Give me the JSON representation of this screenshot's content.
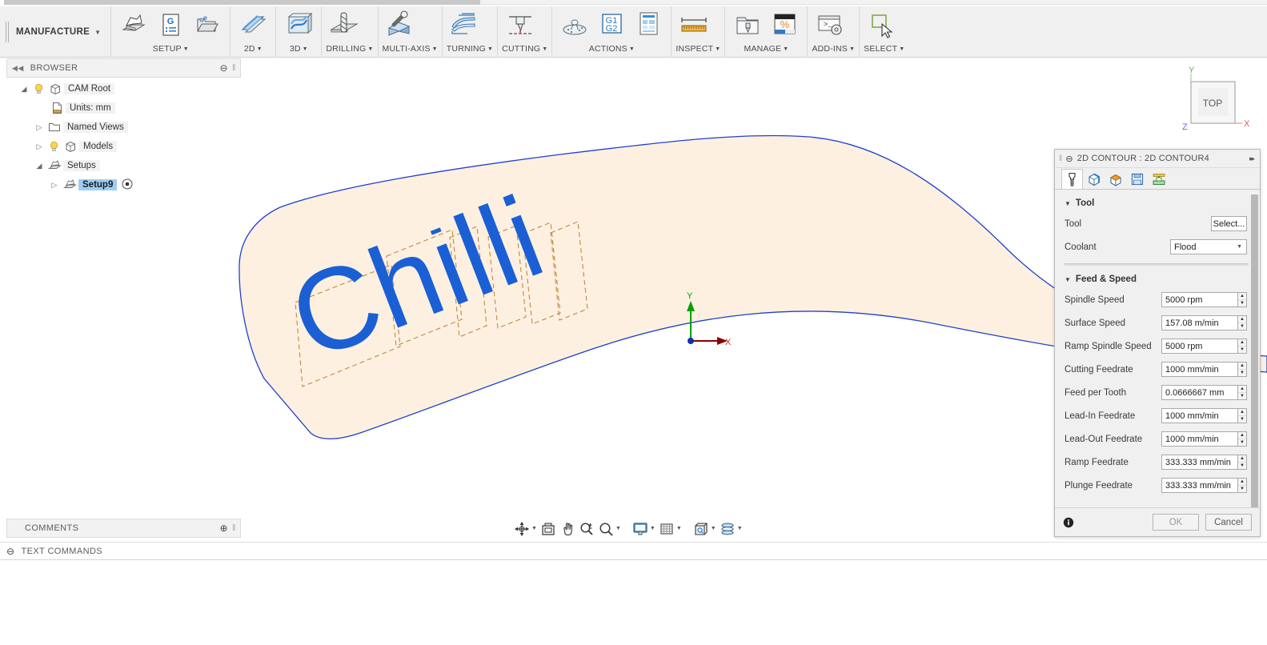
{
  "app": {
    "workspace": "MANUFACTURE"
  },
  "ribbon": {
    "groups": [
      {
        "label": "SETUP",
        "icons": [
          "setup-icon",
          "generate-nc-icon",
          "setup-folder-icon"
        ]
      },
      {
        "label": "2D",
        "icons": [
          "2d-toolpath-icon"
        ]
      },
      {
        "label": "3D",
        "icons": [
          "3d-toolpath-icon"
        ]
      },
      {
        "label": "DRILLING",
        "icons": [
          "drilling-icon"
        ]
      },
      {
        "label": "MULTI-AXIS",
        "icons": [
          "multi-axis-icon"
        ]
      },
      {
        "label": "TURNING",
        "icons": [
          "turning-icon"
        ]
      },
      {
        "label": "CUTTING",
        "icons": [
          "cutting-icon"
        ]
      },
      {
        "label": "ACTIONS",
        "icons": [
          "simulate-icon",
          "g1g2-icon",
          "setup-sheet-icon"
        ]
      },
      {
        "label": "INSPECT",
        "icons": [
          "measure-icon"
        ]
      },
      {
        "label": "MANAGE",
        "icons": [
          "tool-library-icon",
          "machining-time-icon"
        ]
      },
      {
        "label": "ADD-INS",
        "icons": [
          "addins-icon"
        ]
      },
      {
        "label": "SELECT",
        "icons": [
          "select-icon"
        ]
      }
    ]
  },
  "browser": {
    "title": "BROWSER",
    "tree": [
      {
        "label": "CAM Root",
        "icon": "body-icon",
        "twist": "expanded",
        "bulb": true,
        "indent": 0
      },
      {
        "label": "Units: mm",
        "icon": "units-icon",
        "twist": "none",
        "bulb": false,
        "indent": 1
      },
      {
        "label": "Named Views",
        "icon": "folder-icon",
        "twist": "collapsed",
        "bulb": false,
        "indent": 1
      },
      {
        "label": "Models",
        "icon": "body-icon",
        "twist": "collapsed",
        "bulb": true,
        "indent": 1
      },
      {
        "label": "Setups",
        "icon": "setup-small-icon",
        "twist": "expanded",
        "bulb": false,
        "indent": 1
      },
      {
        "label": "Setup9",
        "icon": "setup-small-icon",
        "twist": "collapsed",
        "bulb": false,
        "indent": 2,
        "selected": true,
        "trailing_icon": "target-icon"
      }
    ]
  },
  "canvas": {
    "body_text": "Chilli",
    "body_fill": "#fdf0e1",
    "body_outline": "#2040d0",
    "text_color": "#1b5fd4",
    "selection_box_color": "#c08a3e",
    "origin": {
      "x_label": "X",
      "y_label": "Y",
      "x_color": "#c01010",
      "y_color": "#00a000"
    },
    "viewcube": {
      "face": "TOP",
      "x_label": "X",
      "y_label": "Y",
      "z_label": "Z"
    }
  },
  "navbar": {
    "buttons": [
      {
        "name": "orbit-icon",
        "caret": true
      },
      {
        "name": "look-at-icon",
        "caret": false
      },
      {
        "name": "pan-icon",
        "caret": false
      },
      {
        "name": "zoom-icon",
        "caret": false
      },
      {
        "name": "zoom-window-icon",
        "caret": true
      },
      {
        "name": "display-settings-icon",
        "caret": true
      },
      {
        "name": "grid-snaps-icon",
        "caret": true
      },
      {
        "name": "viewports-icon",
        "caret": true
      },
      {
        "name": "layout-icon",
        "caret": true
      }
    ]
  },
  "comments": {
    "title": "COMMENTS"
  },
  "text_commands": {
    "title": "TEXT COMMANDS"
  },
  "dialog": {
    "title": "2D CONTOUR : 2D CONTOUR4",
    "tabs": [
      {
        "name": "tab-tool",
        "active": true
      },
      {
        "name": "tab-geometry",
        "active": false
      },
      {
        "name": "tab-heights",
        "active": false
      },
      {
        "name": "tab-passes",
        "active": false
      },
      {
        "name": "tab-linking",
        "active": false
      }
    ],
    "sections": [
      {
        "heading": "Tool",
        "rows": [
          {
            "label": "Tool",
            "control": "button",
            "value": "Select..."
          },
          {
            "label": "Coolant",
            "control": "combo",
            "value": "Flood"
          }
        ]
      },
      {
        "heading": "Feed & Speed",
        "rows": [
          {
            "label": "Spindle Speed",
            "control": "spinner",
            "value": "5000 rpm"
          },
          {
            "label": "Surface Speed",
            "control": "spinner",
            "value": "157.08 m/min"
          },
          {
            "label": "Ramp Spindle Speed",
            "control": "spinner",
            "value": "5000 rpm"
          },
          {
            "label": "Cutting Feedrate",
            "control": "spinner",
            "value": "1000 mm/min"
          },
          {
            "label": "Feed per Tooth",
            "control": "spinner",
            "value": "0.0666667 mm"
          },
          {
            "label": "Lead-In Feedrate",
            "control": "spinner",
            "value": "1000 mm/min"
          },
          {
            "label": "Lead-Out Feedrate",
            "control": "spinner",
            "value": "1000 mm/min"
          },
          {
            "label": "Ramp Feedrate",
            "control": "spinner",
            "value": "333.333 mm/min"
          },
          {
            "label": "Plunge Feedrate",
            "control": "spinner",
            "value": "333.333 mm/min"
          }
        ]
      }
    ],
    "footer": {
      "ok": "OK",
      "cancel": "Cancel",
      "info_icon": "info-icon"
    }
  }
}
